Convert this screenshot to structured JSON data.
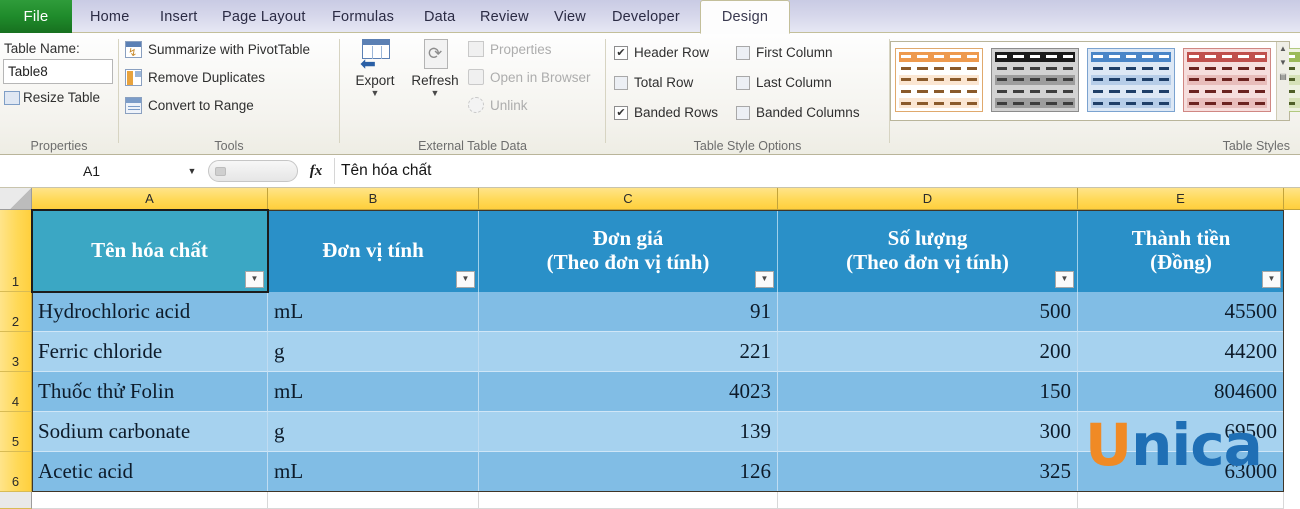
{
  "ribbon": {
    "tabs": [
      {
        "label": "File",
        "active": false,
        "kind": "file"
      },
      {
        "label": "Home",
        "active": false
      },
      {
        "label": "Insert",
        "active": false
      },
      {
        "label": "Page Layout",
        "active": false
      },
      {
        "label": "Formulas",
        "active": false
      },
      {
        "label": "Data",
        "active": false
      },
      {
        "label": "Review",
        "active": false
      },
      {
        "label": "View",
        "active": false
      },
      {
        "label": "Developer",
        "active": false
      },
      {
        "label": "Design",
        "active": true
      }
    ],
    "properties": {
      "group_label": "Properties",
      "table_name_label": "Table Name:",
      "table_name_value": "Table8",
      "resize_table": "Resize Table"
    },
    "tools": {
      "group_label": "Tools",
      "summarize": "Summarize with PivotTable",
      "remove_duplicates": "Remove Duplicates",
      "convert_to_range": "Convert to Range"
    },
    "external": {
      "group_label": "External Table Data",
      "export": "Export",
      "refresh": "Refresh",
      "properties": "Properties",
      "open_in_browser": "Open in Browser",
      "unlink": "Unlink"
    },
    "style_options": {
      "group_label": "Table Style Options",
      "items": [
        {
          "label": "Header Row",
          "checked": true
        },
        {
          "label": "Total Row",
          "checked": false
        },
        {
          "label": "Banded Rows",
          "checked": true
        },
        {
          "label": "First Column",
          "checked": false
        },
        {
          "label": "Last Column",
          "checked": false
        },
        {
          "label": "Banded Columns",
          "checked": false
        }
      ]
    },
    "table_styles": {
      "group_label": "Table Styles",
      "swatches": [
        {
          "name": "orange",
          "header": "#ee9a4e",
          "band_a": "#fbe6d2",
          "band_b": "#ffffff",
          "border": "#e0a96d",
          "mark": "#8a5a2b"
        },
        {
          "name": "black",
          "header": "#1a1a1a",
          "band_a": "#9d9d9d",
          "band_b": "#d2d2d2",
          "border": "#8c8c8c",
          "mark": "#3d3d3d"
        },
        {
          "name": "blue",
          "header": "#4a86c8",
          "band_a": "#b6cde8",
          "band_b": "#dde8f5",
          "border": "#7ba3d0",
          "mark": "#1f3f68"
        },
        {
          "name": "red",
          "header": "#c0504d",
          "band_a": "#e8bdbb",
          "band_b": "#f6dedd",
          "border": "#d08783",
          "mark": "#6b2320"
        },
        {
          "name": "green",
          "header": "#9bbb59",
          "band_a": "#d6e2b8",
          "band_b": "#edf2e0",
          "border": "#b2c97f",
          "mark": "#4f5f28"
        }
      ]
    }
  },
  "formula_bar": {
    "name_box": "A1",
    "value": "Tên hóa chất",
    "fx_label": "fx"
  },
  "sheet": {
    "column_headers": [
      "A",
      "B",
      "C",
      "D",
      "E"
    ],
    "row_headers": [
      "1",
      "2",
      "3",
      "4",
      "5",
      "6"
    ],
    "table_headers": [
      {
        "line1": "Tên hóa chất",
        "line2": ""
      },
      {
        "line1": "Đơn vị tính",
        "line2": ""
      },
      {
        "line1": "Đơn giá",
        "line2": "(Theo đơn vị tính)"
      },
      {
        "line1": "Số lượng",
        "line2": "(Theo đơn vị tính)"
      },
      {
        "line1": "Thành tiền",
        "line2": "(Đồng)"
      }
    ],
    "rows": [
      {
        "row": "2",
        "a": "Hydrochloric acid",
        "b": "mL",
        "c": "91",
        "d": "500",
        "e": "45500"
      },
      {
        "row": "3",
        "a": "Ferric chloride",
        "b": "g",
        "c": "221",
        "d": "200",
        "e": "44200"
      },
      {
        "row": "4",
        "a": "Thuốc thử Folin",
        "b": "mL",
        "c": "4023",
        "d": "150",
        "e": "804600"
      },
      {
        "row": "5",
        "a": "Sodium carbonate",
        "b": "g",
        "c": "139",
        "d": "300",
        "e": "69500"
      },
      {
        "row": "6",
        "a": "Acetic acid",
        "b": "mL",
        "c": "126",
        "d": "325",
        "e": "63000"
      }
    ],
    "selected_cell": "A1",
    "colors": {
      "header_fill": "#2a90c8",
      "header_selected_fill": "#3ba7c4",
      "band_light": "#a6d2ef",
      "band_dark": "#81bde5",
      "row_header": "#ffd958"
    }
  },
  "watermark": {
    "u": "U",
    "rest": "nica"
  }
}
